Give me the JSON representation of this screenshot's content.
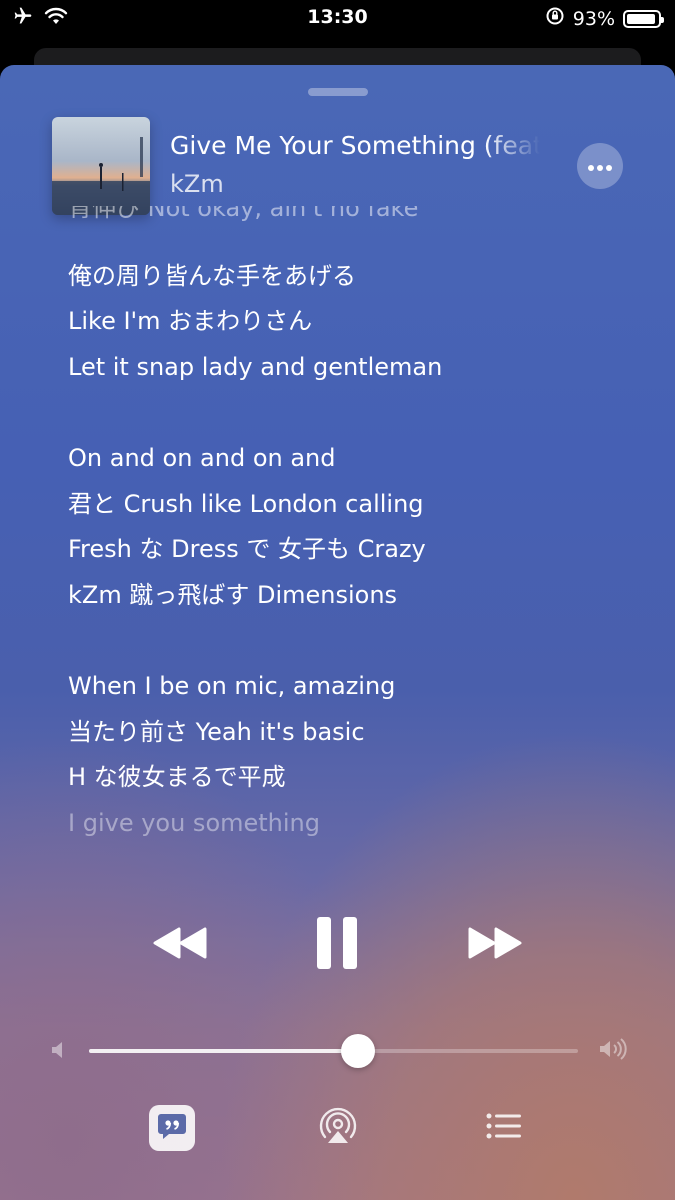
{
  "status_bar": {
    "time": "13:30",
    "battery": "93%",
    "battery_level": 0.93,
    "icons": [
      "airplane-mode-icon",
      "wifi-icon",
      "orientation-lock-icon",
      "battery-icon"
    ]
  },
  "now_playing": {
    "title": "Give Me Your Something (feat",
    "artist": "kZm",
    "more_icon": "ellipsis-icon"
  },
  "lyrics": {
    "partial_line": "背伸び Not okay, ain't no fake",
    "lines": [
      "俺の周り皆んな手をあげる",
      "Like I'm おまわりさん",
      "Let it snap lady and gentleman",
      "",
      "On and on and on and",
      "君と Crush like London calling",
      "Fresh な Dress で 女子も Crazy",
      "kZm 蹴っ飛ばす Dimensions",
      "",
      "When I be on mic, amazing",
      "当たり前さ Yeah it's basic",
      "H な彼女まるで平成",
      "I give you something"
    ]
  },
  "controls": {
    "rewind_icon": "rewind-icon",
    "pause_icon": "pause-icon",
    "forward_icon": "fast-forward-icon"
  },
  "volume": {
    "level": 0.55,
    "min_icon": "speaker-min-icon",
    "max_icon": "speaker-max-icon"
  },
  "bottom_bar": {
    "lyrics_icon": "lyrics-quote-icon",
    "airplay_icon": "airplay-icon",
    "queue_icon": "queue-list-icon"
  },
  "colors": {
    "accent": "#ffffff",
    "background_top": "#4a68b6",
    "background_bottom": "#b07a6c"
  }
}
